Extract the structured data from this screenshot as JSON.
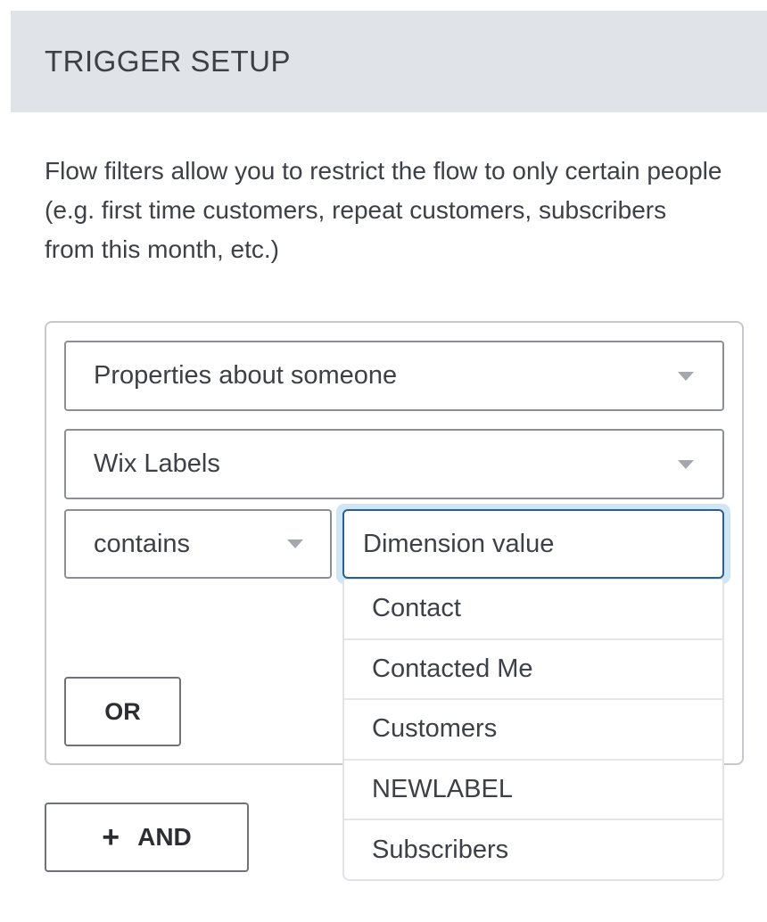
{
  "header": {
    "title": "TRIGGER SETUP"
  },
  "description": "Flow filters allow you to restrict the flow to only certain people (e.g. first time customers, repeat customers, subscribers from this month, etc.)",
  "filter": {
    "condition_type": {
      "selected": "Properties about someone",
      "icon": "caret-down-icon"
    },
    "dimension": {
      "selected": "Wix Labels",
      "icon": "caret-down-icon"
    },
    "operator": {
      "selected": "contains",
      "icon": "caret-down-icon"
    },
    "value": {
      "value": "",
      "placeholder": "Dimension value",
      "focused": true
    },
    "value_options": [
      "Contact",
      "Contacted Me",
      "Customers",
      "NEWLABEL",
      "Subscribers"
    ],
    "or_button": "OR"
  },
  "and_button": {
    "icon": "+",
    "label": "AND"
  },
  "colors": {
    "header_bg": "#e0e3e7",
    "focus_border": "#2e5f8c",
    "focus_glow": "#cfe6f7"
  }
}
